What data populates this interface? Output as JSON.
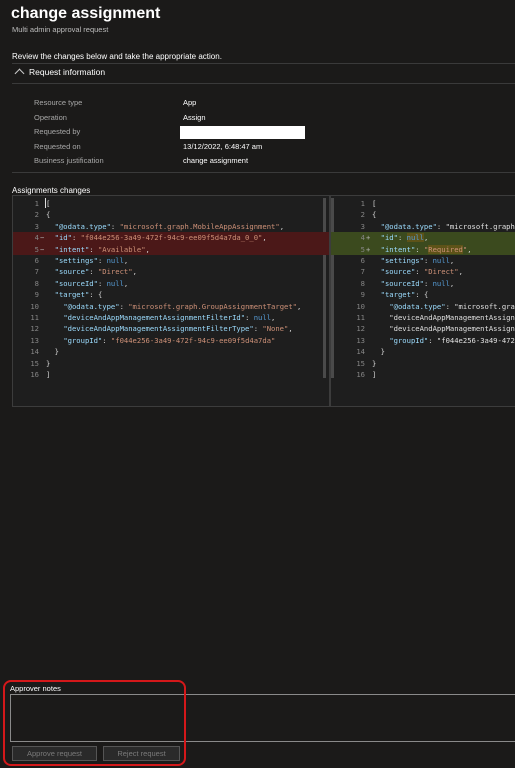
{
  "header": {
    "title": "change assignment",
    "subtitle": "Multi admin approval request",
    "instruction": "Review the changes below and take the appropriate action."
  },
  "request_info": {
    "section_label": "Request information",
    "rows": [
      {
        "label": "Resource type",
        "value": "App"
      },
      {
        "label": "Operation",
        "value": "Assign"
      },
      {
        "label": "Requested by",
        "value": ""
      },
      {
        "label": "Requested on",
        "value": "13/12/2022, 6:48:47 am"
      },
      {
        "label": "Business justification",
        "value": "change assignment"
      }
    ]
  },
  "assignments": {
    "label": "Assignments changes",
    "left": [
      {
        "n": "1",
        "mark": "",
        "text": "[",
        "state": ""
      },
      {
        "n": "2",
        "mark": "",
        "text": "{",
        "state": ""
      },
      {
        "n": "3",
        "mark": "",
        "text": "  \"@odata.type\": \"microsoft.graph.MobileAppAssignment\",",
        "state": ""
      },
      {
        "n": "4",
        "mark": "−",
        "text": "  \"id\": \"f044e256-3a49-472f-94c9-ee09f5d4a7da_0_0\",",
        "state": "del"
      },
      {
        "n": "5",
        "mark": "−",
        "text": "  \"intent\": \"Available\",",
        "state": "del"
      },
      {
        "n": "6",
        "mark": "",
        "text": "  \"settings\": null,",
        "state": ""
      },
      {
        "n": "7",
        "mark": "",
        "text": "  \"source\": \"Direct\",",
        "state": ""
      },
      {
        "n": "8",
        "mark": "",
        "text": "  \"sourceId\": null,",
        "state": ""
      },
      {
        "n": "9",
        "mark": "",
        "text": "  \"target\": {",
        "state": ""
      },
      {
        "n": "10",
        "mark": "",
        "text": "    \"@odata.type\": \"microsoft.graph.GroupAssignmentTarget\",",
        "state": ""
      },
      {
        "n": "11",
        "mark": "",
        "text": "    \"deviceAndAppManagementAssignmentFilterId\": null,",
        "state": ""
      },
      {
        "n": "12",
        "mark": "",
        "text": "    \"deviceAndAppManagementAssignmentFilterType\": \"None\",",
        "state": ""
      },
      {
        "n": "13",
        "mark": "",
        "text": "    \"groupId\": \"f044e256-3a49-472f-94c9-ee09f5d4a7da\"",
        "state": ""
      },
      {
        "n": "14",
        "mark": "",
        "text": "  }",
        "state": ""
      },
      {
        "n": "15",
        "mark": "",
        "text": "}",
        "state": ""
      },
      {
        "n": "16",
        "mark": "",
        "text": "]",
        "state": ""
      }
    ],
    "right": [
      {
        "n": "1",
        "mark": "",
        "text": "[",
        "state": ""
      },
      {
        "n": "2",
        "mark": "",
        "text": "{",
        "state": ""
      },
      {
        "n": "3",
        "mark": "",
        "text": "  \"@odata.type\": \"microsoft.graph.",
        "state": ""
      },
      {
        "n": "4",
        "mark": "+",
        "text": "  \"id\": null,",
        "state": "add"
      },
      {
        "n": "5",
        "mark": "+",
        "text": "  \"intent\": \"Required\",",
        "state": "add"
      },
      {
        "n": "6",
        "mark": "",
        "text": "  \"settings\": null,",
        "state": ""
      },
      {
        "n": "7",
        "mark": "",
        "text": "  \"source\": \"Direct\",",
        "state": ""
      },
      {
        "n": "8",
        "mark": "",
        "text": "  \"sourceId\": null,",
        "state": ""
      },
      {
        "n": "9",
        "mark": "",
        "text": "  \"target\": {",
        "state": ""
      },
      {
        "n": "10",
        "mark": "",
        "text": "    \"@odata.type\": \"microsoft.graph",
        "state": ""
      },
      {
        "n": "11",
        "mark": "",
        "text": "    \"deviceAndAppManagementAssignme",
        "state": ""
      },
      {
        "n": "12",
        "mark": "",
        "text": "    \"deviceAndAppManagementAssignme",
        "state": ""
      },
      {
        "n": "13",
        "mark": "",
        "text": "    \"groupId\": \"f044e256-3a49-472f-",
        "state": ""
      },
      {
        "n": "14",
        "mark": "",
        "text": "  }",
        "state": ""
      },
      {
        "n": "15",
        "mark": "",
        "text": "}",
        "state": ""
      },
      {
        "n": "16",
        "mark": "",
        "text": "]",
        "state": ""
      }
    ]
  },
  "approver": {
    "notes_label": "Approver notes",
    "notes_value": "",
    "approve_label": "Approve request",
    "reject_label": "Reject request"
  },
  "colors": {
    "deleted_line": "#4b1818",
    "added_line": "#3b4a1e",
    "highlight_border": "#d4181a"
  }
}
